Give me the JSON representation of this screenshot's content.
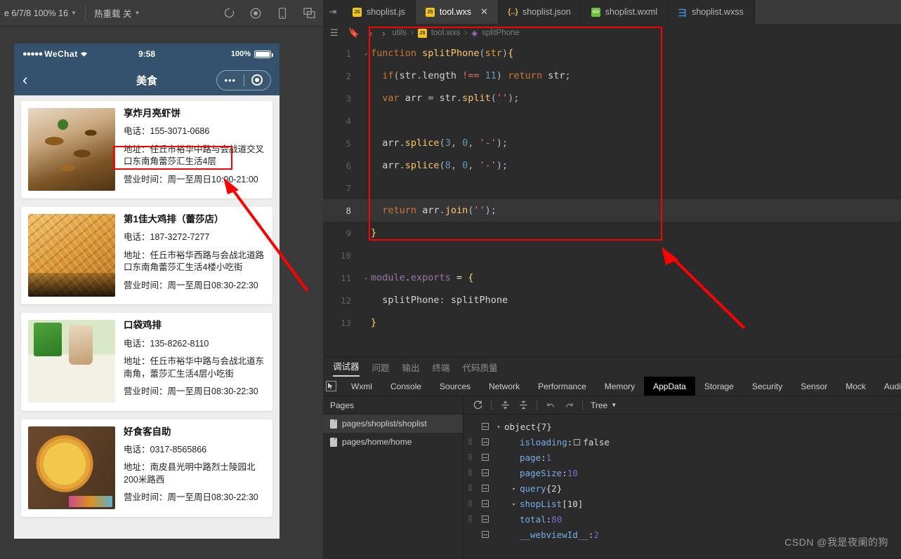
{
  "toolbar": {
    "device_label": "e 6/7/8 100% 16",
    "hot_reload_label": "热重载 关",
    "icons": [
      "refresh-icon",
      "compile-icon",
      "preview-device-icon",
      "split-view-icon"
    ]
  },
  "simulator": {
    "status_bar": {
      "carrier": "WeChat",
      "signal_dots": "●●●●●",
      "time": "9:58",
      "battery_percent": "100%"
    },
    "nav_bar": {
      "back_icon": "chevron-left-icon",
      "title": "美食",
      "capsule_dots": "•••",
      "capsule_target_icon": "target-icon"
    },
    "shops": [
      {
        "name": "享炸月亮虾饼",
        "phone": "电话：155-3071-0686",
        "address": "地址：任丘市裕华中路与会战道交叉口东南角蕾莎汇生活4层",
        "hours": "营业时间：周一至周日10:00-21:00",
        "thumb": "th-noodle"
      },
      {
        "name": "第1佳大鸡排（蕾莎店）",
        "phone": "电话：187-3272-7277",
        "address": "地址：任丘市裕华西路与会战北道路口东南角蕾莎汇生活4楼小吃街",
        "hours": "营业时间：周一至周日08:30-22:30",
        "thumb": "th-chicken"
      },
      {
        "name": "口袋鸡排",
        "phone": "电话：135-8262-8110",
        "address": "地址：任丘市裕华中路与会战北道东南角，蕾莎汇生活4层小吃街",
        "hours": "营业时间：周一至周日08:30-22:30",
        "thumb": "th-milk"
      },
      {
        "name": "好食客自助",
        "phone": "电话：0317-8565866",
        "address": "地址：南皮县光明中路烈士陵园北200米路西",
        "hours": "营业时间：周一至周日08:30-22:30",
        "thumb": "th-pizza"
      }
    ]
  },
  "editor": {
    "tabs": [
      {
        "label": "shoplist.js",
        "icon": "js-file-icon",
        "active": false,
        "closable": false
      },
      {
        "label": "tool.wxs",
        "icon": "js-file-icon",
        "active": true,
        "closable": true
      },
      {
        "label": "shoplist.json",
        "icon": "json-file-icon",
        "active": false,
        "closable": false
      },
      {
        "label": "shoplist.wxml",
        "icon": "wxml-file-icon",
        "active": false,
        "closable": false
      },
      {
        "label": "shoplist.wxss",
        "icon": "wxss-file-icon",
        "active": false,
        "closable": false
      }
    ],
    "close_glyph": "✕",
    "breadcrumb": [
      "utils",
      "tool.wxs",
      "splitPhone"
    ],
    "breadcrumb_sep": "›",
    "code_lines": [
      {
        "n": "1",
        "fold": "⌄",
        "highlight": false
      },
      {
        "n": "2",
        "fold": "",
        "highlight": false
      },
      {
        "n": "3",
        "fold": "",
        "highlight": false
      },
      {
        "n": "4",
        "fold": "",
        "highlight": false
      },
      {
        "n": "5",
        "fold": "",
        "highlight": false
      },
      {
        "n": "6",
        "fold": "",
        "highlight": false
      },
      {
        "n": "7",
        "fold": "",
        "highlight": false
      },
      {
        "n": "8",
        "fold": "",
        "highlight": true
      },
      {
        "n": "9",
        "fold": "",
        "highlight": false
      },
      {
        "n": "10",
        "fold": "",
        "highlight": false
      },
      {
        "n": "11",
        "fold": "⌄",
        "highlight": false
      },
      {
        "n": "12",
        "fold": "",
        "highlight": false
      },
      {
        "n": "13",
        "fold": "",
        "highlight": false
      }
    ],
    "code_text": [
      "function splitPhone(str){",
      "  if(str.length !== 11) return str;",
      "  var arr = str.split('');",
      "",
      "  arr.splice(3, 0, '-');",
      "  arr.splice(8, 0, '-');",
      "",
      "  return arr.join('');",
      "}",
      "",
      "module.exports = {",
      "  splitPhone: splitPhone",
      "}"
    ]
  },
  "debugger": {
    "top_tabs": [
      {
        "label": "调试器",
        "active": true
      },
      {
        "label": "问题",
        "active": false
      },
      {
        "label": "输出",
        "active": false
      },
      {
        "label": "终端",
        "active": false
      },
      {
        "label": "代码质量",
        "active": false
      }
    ],
    "sub_tabs": [
      {
        "label": "Wxml",
        "active": false
      },
      {
        "label": "Console",
        "active": false
      },
      {
        "label": "Sources",
        "active": false
      },
      {
        "label": "Network",
        "active": false
      },
      {
        "label": "Performance",
        "active": false
      },
      {
        "label": "Memory",
        "active": false
      },
      {
        "label": "AppData",
        "active": true
      },
      {
        "label": "Storage",
        "active": false
      },
      {
        "label": "Security",
        "active": false
      },
      {
        "label": "Sensor",
        "active": false
      },
      {
        "label": "Mock",
        "active": false
      },
      {
        "label": "Audits",
        "active": false
      }
    ],
    "pages_header": "Pages",
    "pages": [
      {
        "label": "pages/shoplist/shoplist",
        "selected": true
      },
      {
        "label": "pages/home/home",
        "selected": false
      }
    ],
    "data_toolbar": {
      "refresh_icon": "refresh-icon",
      "expand_icon": "expand-all-icon",
      "collapse_icon": "collapse-all-icon",
      "undo_icon": "undo-icon",
      "redo_icon": "redo-icon",
      "view_mode": "Tree",
      "view_caret": "▼"
    },
    "tree": [
      {
        "indent": 0,
        "grip": false,
        "twisty": "▾",
        "key": "object",
        "sep": "",
        "value": "{7}",
        "value_type": "plain",
        "checkbox": false
      },
      {
        "indent": 1,
        "grip": true,
        "twisty": "",
        "key": "isloading",
        "sep": ":",
        "value": "false",
        "value_type": "plain",
        "checkbox": true
      },
      {
        "indent": 1,
        "grip": true,
        "twisty": "",
        "key": "page",
        "sep": ":",
        "value": "1",
        "value_type": "num",
        "checkbox": false
      },
      {
        "indent": 1,
        "grip": true,
        "twisty": "",
        "key": "pageSize",
        "sep": ":",
        "value": "10",
        "value_type": "num",
        "checkbox": false
      },
      {
        "indent": 1,
        "grip": true,
        "twisty": "▸",
        "key": "query",
        "sep": "",
        "value": "{2}",
        "value_type": "plain",
        "checkbox": false
      },
      {
        "indent": 1,
        "grip": true,
        "twisty": "▸",
        "key": "shopList",
        "sep": "",
        "value": "[10]",
        "value_type": "plain",
        "checkbox": false
      },
      {
        "indent": 1,
        "grip": true,
        "twisty": "",
        "key": "total",
        "sep": ":",
        "value": "80",
        "value_type": "num",
        "checkbox": false
      },
      {
        "indent": 1,
        "grip": false,
        "twisty": "",
        "key": "__webviewId__",
        "sep": ":",
        "value": "2",
        "value_type": "num",
        "checkbox": false
      }
    ]
  },
  "annotation": {
    "accent_color": "#ff0000",
    "boxes": [
      "phone-number-highlight",
      "code-function-highlight"
    ],
    "arrows": [
      "arrow-to-shop-address",
      "arrow-to-code-block"
    ]
  },
  "watermark": "CSDN @我是夜阑的狗"
}
